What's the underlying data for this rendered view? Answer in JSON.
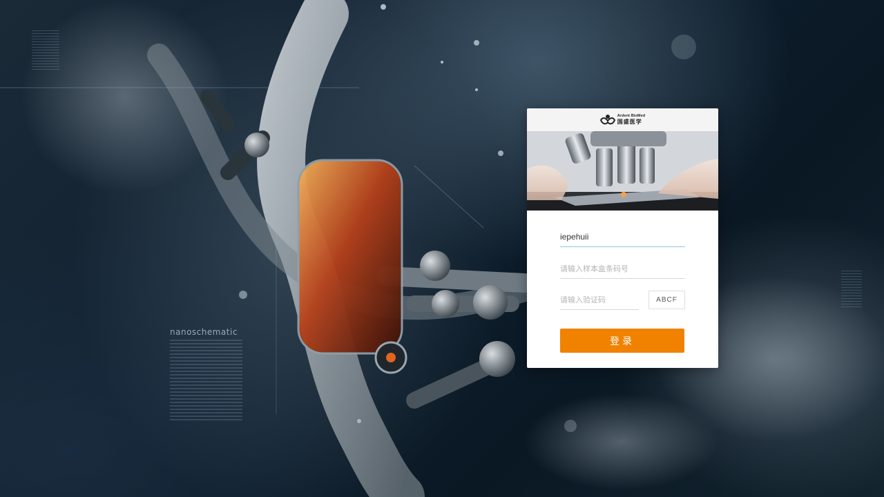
{
  "background": {
    "hud_label": "nanoschematic",
    "colors": {
      "backdrop": "#102030",
      "helix": "#9aa4ab",
      "core_glow": "#e0651e"
    }
  },
  "card": {
    "logo": {
      "name_en": "Ardent BioMed",
      "name_cn": "国盛医学",
      "icon": "ardent-biomed-logo-icon"
    },
    "banner": {
      "icon": "microscope-photo"
    },
    "username": {
      "value": "iepehuii",
      "placeholder": ""
    },
    "sample_code": {
      "value": "",
      "placeholder": "请输入样本盒条码号"
    },
    "captcha": {
      "value": "",
      "placeholder": "请输入验证码",
      "code": "ABCF"
    },
    "login_button": "登录",
    "colors": {
      "accent": "#f08200",
      "active_underline": "#8fc3e6"
    }
  }
}
